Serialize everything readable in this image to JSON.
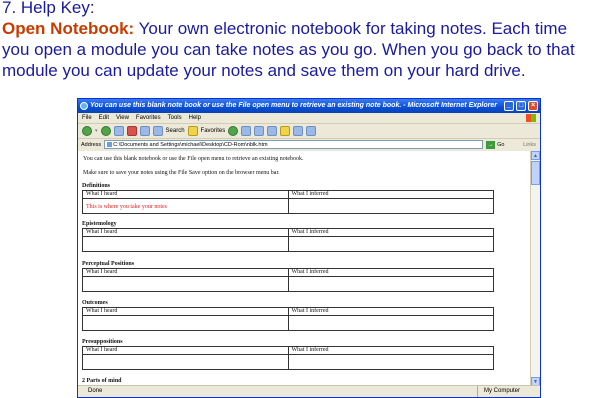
{
  "help": {
    "heading": "7. Help Key:",
    "lead": "Open Notebook:",
    "description": " Your own electronic notebook for taking notes. Each time you open a module you can take notes as you go. When you go back to that module you can update your notes and save them on your hard drive."
  },
  "window": {
    "title": "You can use this blank note book or use the File open menu to retrieve an existing note book. - Microsoft Internet Explorer",
    "menus": [
      "File",
      "Edit",
      "View",
      "Favorites",
      "Tools",
      "Help"
    ],
    "toolbar": {
      "search": "Search",
      "favorites": "Favorites"
    },
    "address_label": "Address",
    "address": "C:\\Documents and Settings\\michael\\Desktop\\CD-Rom\\nblk.htm",
    "go": "Go",
    "links": "Links"
  },
  "page": {
    "intro1": "You can use this blank notebook or use the File open menu to retrieve an existing notebook.",
    "intro2": "Make sure to save your notes using the File Save option on the browser menu bar.",
    "col_heard": "What I heard",
    "col_inferred": "What I inferred",
    "placeholder": "This is where you take your notes",
    "sections": [
      "Definitions",
      "Epistemology",
      "Perceptual Positions",
      "Outcomes",
      "Presuppositions",
      "2 Parts of mind"
    ]
  },
  "status": {
    "done": "Done",
    "zone": "My Computer"
  }
}
